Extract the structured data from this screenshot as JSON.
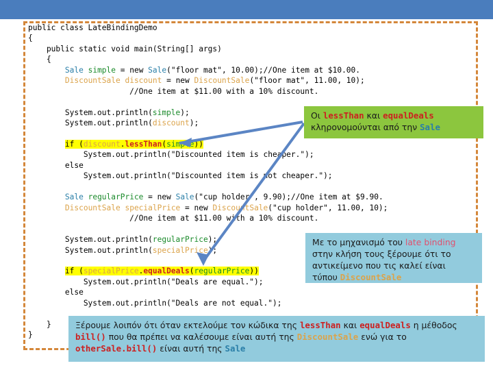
{
  "slide": {
    "header_band_color": "#4a7dbd",
    "frame_border_color": "#d4873a",
    "highlight_color": "#ffff00",
    "green_callout_color": "#8cc63e",
    "cyan_callout_color": "#92cbdd",
    "arrow_color": "#5b85c4"
  },
  "code": {
    "language": "java",
    "lines": [
      "public class LateBindingDemo",
      "{",
      "    public static void main(String[] args)",
      "    {",
      "        Sale simple = new Sale(\"floor mat\", 10.00);//One item at $10.00.",
      "        DiscountSale discount = new DiscountSale(\"floor mat\", 11.00, 10);",
      "                      //One item at $11.00 with a 10% discount.",
      "",
      "        System.out.println(simple);",
      "        System.out.println(discount);",
      "",
      "        if (discount.lessThan(simple))",
      "            System.out.println(\"Discounted item is cheaper.\");",
      "        else",
      "            System.out.println(\"Discounted item is not cheaper.\");",
      "",
      "        Sale regularPrice = new Sale(\"cup holder\", 9.90);//One item at $9.90.",
      "        DiscountSale specialPrice = new DiscountSale(\"cup holder\", 11.00, 10);",
      "                      //One item at $11.00 with a 10% discount.",
      "",
      "        System.out.println(regularPrice);",
      "        System.out.println(specialPrice);",
      "",
      "        if (specialPrice.equalDeals(regularPrice))",
      "            System.out.println(\"Deals are equal.\");",
      "        else",
      "            System.out.println(\"Deals are not equal.\");",
      "",
      "    }",
      "}"
    ],
    "highlighted_lines": [
      11,
      23
    ],
    "class_name": "LateBindingDemo",
    "method_name": "main",
    "types": [
      "Sale",
      "DiscountSale",
      "String"
    ],
    "variables": [
      "simple",
      "discount",
      "regularPrice",
      "specialPrice"
    ],
    "methods_called": [
      "lessThan",
      "equalDeals",
      "System.out.println"
    ],
    "literals": [
      "\"floor mat\"",
      "\"cup holder\"",
      "10.00",
      "11.00",
      "9.90",
      "10"
    ],
    "comments": [
      "//One item at $10.00.",
      "//One item at $11.00 with a 10% discount.",
      "//One item at $9.90.",
      "//One item at $11.00 with a 10% discount."
    ],
    "strings": [
      "\"Discounted item is cheaper.\"",
      "\"Discounted item is not cheaper.\"",
      "\"Deals are equal.\"",
      "\"Deals are not equal.\""
    ]
  },
  "callouts": {
    "green": {
      "line1_pre": "Οι ",
      "line1_kw1": "lessThan",
      "line1_mid": " και ",
      "line1_kw2": "equalDeals",
      "line2_pre": "κληρονομούνται από την ",
      "line2_kw": "Sale",
      "full_text": "Οι lessThan και equalDeals κληρονομούνται από την Sale"
    },
    "cyan1": {
      "line1_pre": "Με το μηχανισμό του ",
      "line1_kw": "late binding",
      "line2": "στην κλήση τους ξέρουμε ότι το",
      "line3": "αντικείμενο που τις καλεί είναι",
      "line4_pre": "τύπου ",
      "line4_kw": "DiscountSale",
      "full_text": "Με το μηχανισμό του late binding στην κλήση τους ξέρουμε ότι το αντικείμενο που τις καλεί είναι τύπου DiscountSale"
    },
    "cyan2": {
      "seg1": "Ξέρουμε λοιπόν ότι όταν εκτελούμε τον κώδικα της ",
      "kw1": "lessThan",
      "seg2": " και ",
      "kw2": "equalDeals",
      "seg3": " η μέθοδος ",
      "kw3": "bill()",
      "seg4": " που θα πρέπει να καλέσουμε είναι αυτή της ",
      "kw4": "DiscountSale",
      "seg5": " ενώ για το ",
      "kw5": "otherSale.bill()",
      "seg6": " είναι αυτή της ",
      "kw6": "Sale",
      "full_text": "Ξέρουμε λοιπόν ότι όταν εκτελούμε τον κώδικα της lessThan και equalDeals η μέθοδος bill() που θα πρέπει να καλέσουμε είναι αυτή της DiscountSale ενώ για το otherSale.bill() είναι αυτή της Sale"
    }
  },
  "arrows": [
    {
      "name": "arrow-to-lessthan",
      "from": "green-callout",
      "to": "lessThan-call"
    },
    {
      "name": "arrow-to-equaldeals",
      "from": "green-callout",
      "to": "equalDeals-call"
    }
  ]
}
